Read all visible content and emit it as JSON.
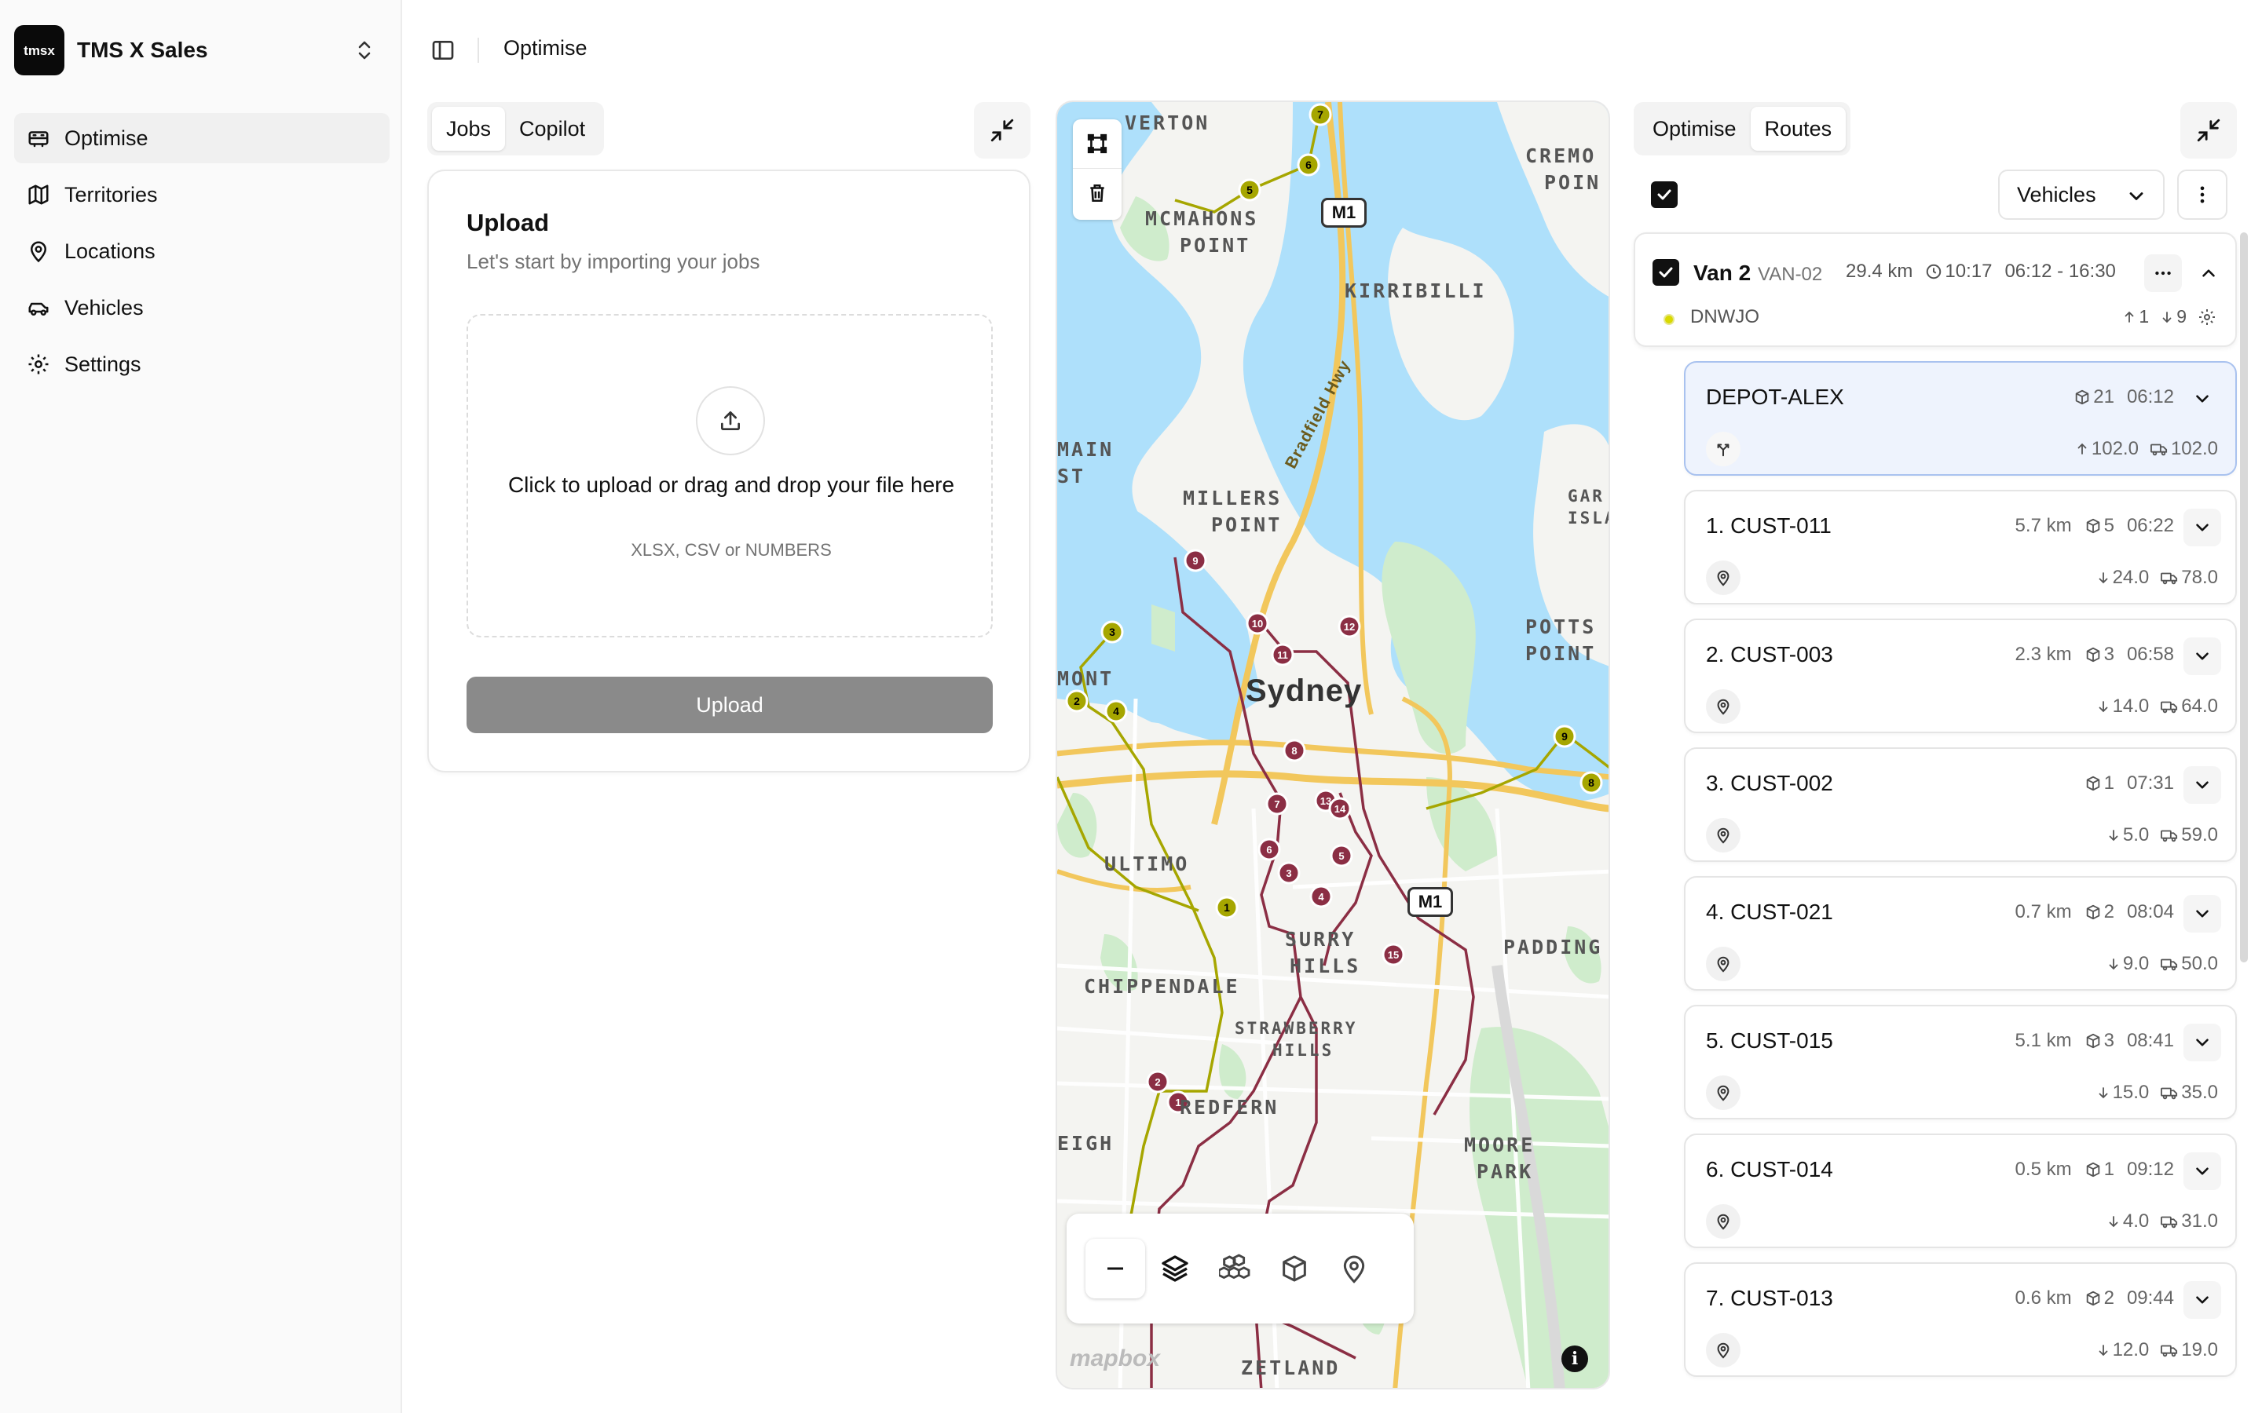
{
  "sidebar": {
    "brand": {
      "logo_text": "tmsx",
      "name": "TMS X Sales"
    },
    "items": [
      {
        "label": "Optimise",
        "icon": "truck-icon",
        "active": true
      },
      {
        "label": "Territories",
        "icon": "map-icon",
        "active": false
      },
      {
        "label": "Locations",
        "icon": "pin-icon",
        "active": false
      },
      {
        "label": "Vehicles",
        "icon": "car-icon",
        "active": false
      },
      {
        "label": "Settings",
        "icon": "gear-icon",
        "active": false
      }
    ]
  },
  "header": {
    "title": "Optimise"
  },
  "left_panel": {
    "tabs": [
      {
        "label": "Jobs",
        "active": true
      },
      {
        "label": "Copilot",
        "active": false
      }
    ],
    "upload": {
      "title": "Upload",
      "subtitle": "Let's start by importing your jobs",
      "dropzone_text": "Click to upload or drag and drop your file here",
      "formats": "XLSX, CSV or NUMBERS",
      "button_label": "Upload"
    }
  },
  "map": {
    "labels": {
      "overton": "VERTON",
      "cremorne": "CREMO",
      "cremorne2": "POIN",
      "mcmahons": "MCMAHONS",
      "mcmahons2": "POINT",
      "kirribilli": "KIRRIBILLI",
      "main": "MAIN",
      "st": "ST",
      "millers": "MILLERS",
      "millers2": "POINT",
      "garden": "GAR",
      "garden2": "ISLA",
      "potts": "POTTS",
      "potts2": "POINT",
      "mont": "MONT",
      "sydney": "Sydney",
      "ultimo": "ULTIMO",
      "surry": "SURRY",
      "surry2": "HILLS",
      "padding": "PADDING",
      "chippendale": "CHIPPENDALE",
      "strawberry": "STRAWBERRY",
      "strawberry2": "HILLS",
      "redfern": "REDFERN",
      "eigh": "EIGH",
      "moore": "MOORE",
      "moore2": "PARK",
      "zetland": "ZETLAND",
      "bradfield": "Bradfield Hwy",
      "m1": "M1",
      "mapbox": "mapbox",
      "info": "i"
    },
    "route_colors": {
      "yellow": "#a6a600",
      "maroon": "#8b2e44",
      "road": "#f2c75c"
    }
  },
  "right_panel": {
    "tabs": [
      {
        "label": "Optimise",
        "active": false
      },
      {
        "label": "Routes",
        "active": true
      }
    ],
    "filter_label": "Vehicles",
    "vehicle": {
      "name": "Van 2",
      "code": "VAN-02",
      "distance": "29.4 km",
      "duration": "10:17",
      "window": "06:12 - 16:30",
      "driver": "DNWJO",
      "up_count": "1",
      "down_count": "9"
    },
    "stops": [
      {
        "name": "DEPOT-ALEX",
        "distance": "",
        "items": "21",
        "time": "06:12",
        "load_a": "102.0",
        "load_b": "102.0",
        "depot": true
      },
      {
        "name": "1. CUST-011",
        "distance": "5.7 km",
        "items": "5",
        "time": "06:22",
        "load_a": "24.0",
        "load_b": "78.0"
      },
      {
        "name": "2. CUST-003",
        "distance": "2.3 km",
        "items": "3",
        "time": "06:58",
        "load_a": "14.0",
        "load_b": "64.0"
      },
      {
        "name": "3. CUST-002",
        "distance": "",
        "items": "1",
        "time": "07:31",
        "load_a": "5.0",
        "load_b": "59.0"
      },
      {
        "name": "4. CUST-021",
        "distance": "0.7 km",
        "items": "2",
        "time": "08:04",
        "load_a": "9.0",
        "load_b": "50.0"
      },
      {
        "name": "5. CUST-015",
        "distance": "5.1 km",
        "items": "3",
        "time": "08:41",
        "load_a": "15.0",
        "load_b": "35.0"
      },
      {
        "name": "6. CUST-014",
        "distance": "0.5 km",
        "items": "1",
        "time": "09:12",
        "load_a": "4.0",
        "load_b": "31.0"
      },
      {
        "name": "7. CUST-013",
        "distance": "0.6 km",
        "items": "2",
        "time": "09:44",
        "load_a": "12.0",
        "load_b": "19.0"
      }
    ]
  }
}
